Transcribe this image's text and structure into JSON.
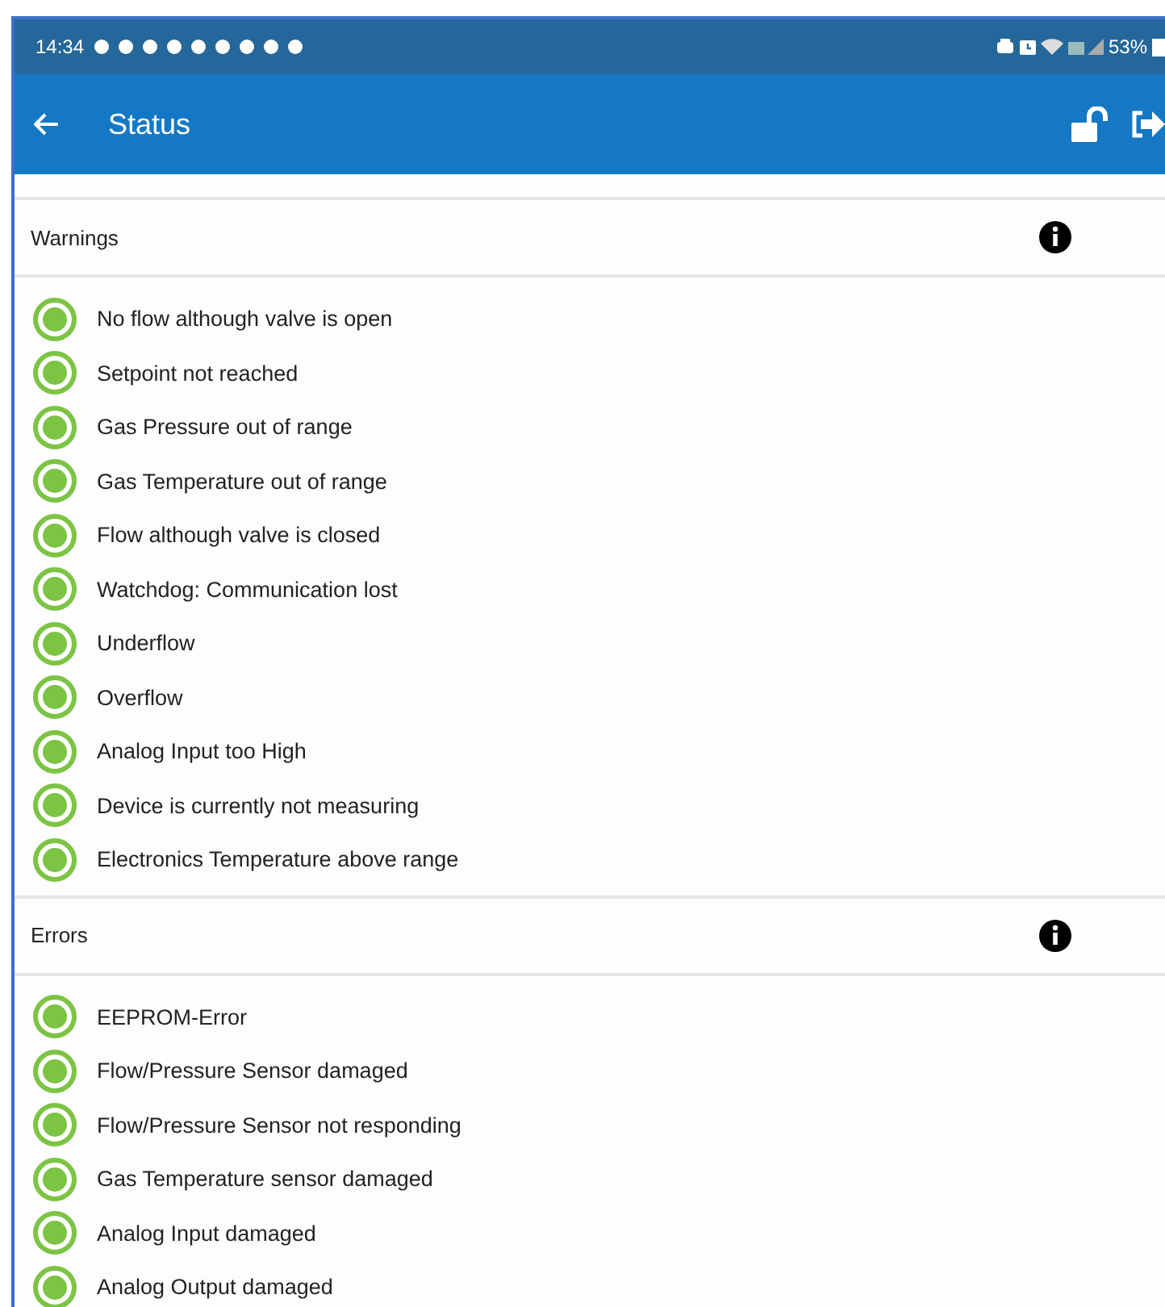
{
  "status_bar": {
    "time": "14:34",
    "battery": "53%"
  },
  "app_bar": {
    "title": "Status"
  },
  "sections": [
    {
      "title": "Warnings",
      "items": [
        {
          "label": "No flow although valve is open",
          "ok": true
        },
        {
          "label": "Setpoint not reached",
          "ok": true
        },
        {
          "label": "Gas Pressure out of range",
          "ok": true
        },
        {
          "label": "Gas Temperature out of range",
          "ok": true
        },
        {
          "label": "Flow although valve is closed",
          "ok": true
        },
        {
          "label": "Watchdog: Communication lost",
          "ok": true
        },
        {
          "label": "Underflow",
          "ok": true
        },
        {
          "label": "Overflow",
          "ok": true
        },
        {
          "label": "Analog Input too High",
          "ok": true
        },
        {
          "label": "Device is currently not measuring",
          "ok": true
        },
        {
          "label": "Electronics Temperature above range",
          "ok": true
        }
      ]
    },
    {
      "title": "Errors",
      "items": [
        {
          "label": "EEPROM-Error",
          "ok": true
        },
        {
          "label": "Flow/Pressure Sensor damaged",
          "ok": true
        },
        {
          "label": "Flow/Pressure Sensor not responding",
          "ok": true
        },
        {
          "label": "Gas Temperature sensor damaged",
          "ok": true
        },
        {
          "label": "Analog Input damaged",
          "ok": true
        },
        {
          "label": "Analog Output damaged",
          "ok": true
        }
      ]
    }
  ]
}
